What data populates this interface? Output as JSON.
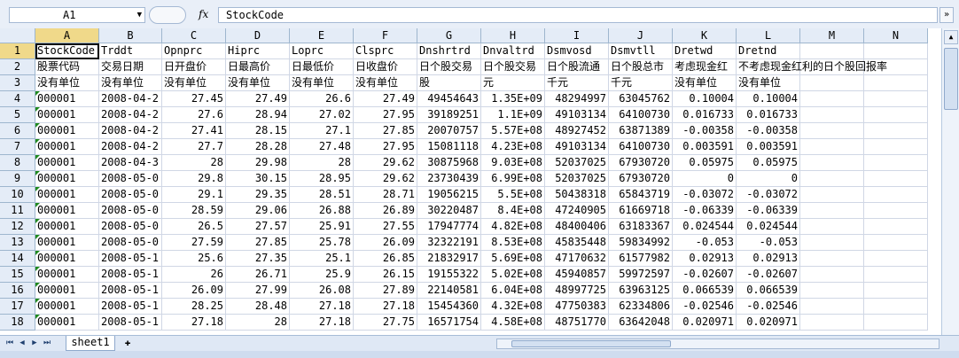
{
  "formula_bar": {
    "name_box": "A1",
    "fx": "fx",
    "formula": "StockCode",
    "expand_icon": "chevron-down-icon"
  },
  "columns": [
    "A",
    "B",
    "C",
    "D",
    "E",
    "F",
    "G",
    "H",
    "I",
    "J",
    "K",
    "L",
    "M",
    "N"
  ],
  "rows": [
    [
      "StockCode",
      "Trddt",
      "Opnprc",
      "Hiprc",
      "Loprc",
      "Clsprc",
      "Dnshrtrd",
      "Dnvaltrd",
      "Dsmvosd",
      "Dsmvtll",
      "Dretwd",
      "Dretnd",
      "",
      ""
    ],
    [
      "股票代码",
      "交易日期",
      "日开盘价",
      "日最高价",
      "日最低价",
      "日收盘价",
      "日个股交易",
      "日个股交易",
      "日个股流通",
      "日个股总市",
      "考虑现金红",
      "不考虑现金红利的日个股回报率",
      "",
      ""
    ],
    [
      "没有单位",
      "没有单位",
      "没有单位",
      "没有单位",
      "没有单位",
      "没有单位",
      "股",
      "元",
      "千元",
      "千元",
      "没有单位",
      "没有单位",
      "",
      ""
    ],
    [
      "000001",
      "2008-04-2",
      "27.45",
      "27.49",
      "26.6",
      "27.49",
      "49454643",
      "1.35E+09",
      "48294997",
      "63045762",
      "0.10004",
      "0.10004",
      "",
      ""
    ],
    [
      "000001",
      "2008-04-2",
      "27.6",
      "28.94",
      "27.02",
      "27.95",
      "39189251",
      "1.1E+09",
      "49103134",
      "64100730",
      "0.016733",
      "0.016733",
      "",
      ""
    ],
    [
      "000001",
      "2008-04-2",
      "27.41",
      "28.15",
      "27.1",
      "27.85",
      "20070757",
      "5.57E+08",
      "48927452",
      "63871389",
      "-0.00358",
      "-0.00358",
      "",
      ""
    ],
    [
      "000001",
      "2008-04-2",
      "27.7",
      "28.28",
      "27.48",
      "27.95",
      "15081118",
      "4.23E+08",
      "49103134",
      "64100730",
      "0.003591",
      "0.003591",
      "",
      ""
    ],
    [
      "000001",
      "2008-04-3",
      "28",
      "29.98",
      "28",
      "29.62",
      "30875968",
      "9.03E+08",
      "52037025",
      "67930720",
      "0.05975",
      "0.05975",
      "",
      ""
    ],
    [
      "000001",
      "2008-05-0",
      "29.8",
      "30.15",
      "28.95",
      "29.62",
      "23730439",
      "6.99E+08",
      "52037025",
      "67930720",
      "0",
      "0",
      "",
      ""
    ],
    [
      "000001",
      "2008-05-0",
      "29.1",
      "29.35",
      "28.51",
      "28.71",
      "19056215",
      "5.5E+08",
      "50438318",
      "65843719",
      "-0.03072",
      "-0.03072",
      "",
      ""
    ],
    [
      "000001",
      "2008-05-0",
      "28.59",
      "29.06",
      "26.88",
      "26.89",
      "30220487",
      "8.4E+08",
      "47240905",
      "61669718",
      "-0.06339",
      "-0.06339",
      "",
      ""
    ],
    [
      "000001",
      "2008-05-0",
      "26.5",
      "27.57",
      "25.91",
      "27.55",
      "17947774",
      "4.82E+08",
      "48400406",
      "63183367",
      "0.024544",
      "0.024544",
      "",
      ""
    ],
    [
      "000001",
      "2008-05-0",
      "27.59",
      "27.85",
      "25.78",
      "26.09",
      "32322191",
      "8.53E+08",
      "45835448",
      "59834992",
      "-0.053",
      "-0.053",
      "",
      ""
    ],
    [
      "000001",
      "2008-05-1",
      "25.6",
      "27.35",
      "25.1",
      "26.85",
      "21832917",
      "5.69E+08",
      "47170632",
      "61577982",
      "0.02913",
      "0.02913",
      "",
      ""
    ],
    [
      "000001",
      "2008-05-1",
      "26",
      "26.71",
      "25.9",
      "26.15",
      "19155322",
      "5.02E+08",
      "45940857",
      "59972597",
      "-0.02607",
      "-0.02607",
      "",
      ""
    ],
    [
      "000001",
      "2008-05-1",
      "26.09",
      "27.99",
      "26.08",
      "27.89",
      "22140581",
      "6.04E+08",
      "48997725",
      "63963125",
      "0.066539",
      "0.066539",
      "",
      ""
    ],
    [
      "000001",
      "2008-05-1",
      "28.25",
      "28.48",
      "27.18",
      "27.18",
      "15454360",
      "4.32E+08",
      "47750383",
      "62334806",
      "-0.02546",
      "-0.02546",
      "",
      ""
    ],
    [
      "000001",
      "2008-05-1",
      "27.18",
      "28",
      "27.18",
      "27.75",
      "16571754",
      "4.58E+08",
      "48751770",
      "63642048",
      "0.020971",
      "0.020971",
      "",
      ""
    ]
  ],
  "sheet_tabs": [
    "sheet1"
  ],
  "colors": {
    "header_bg": "#e4ecf7",
    "grid_line": "#d0d7e5",
    "selected_header": "#f0d98a"
  }
}
